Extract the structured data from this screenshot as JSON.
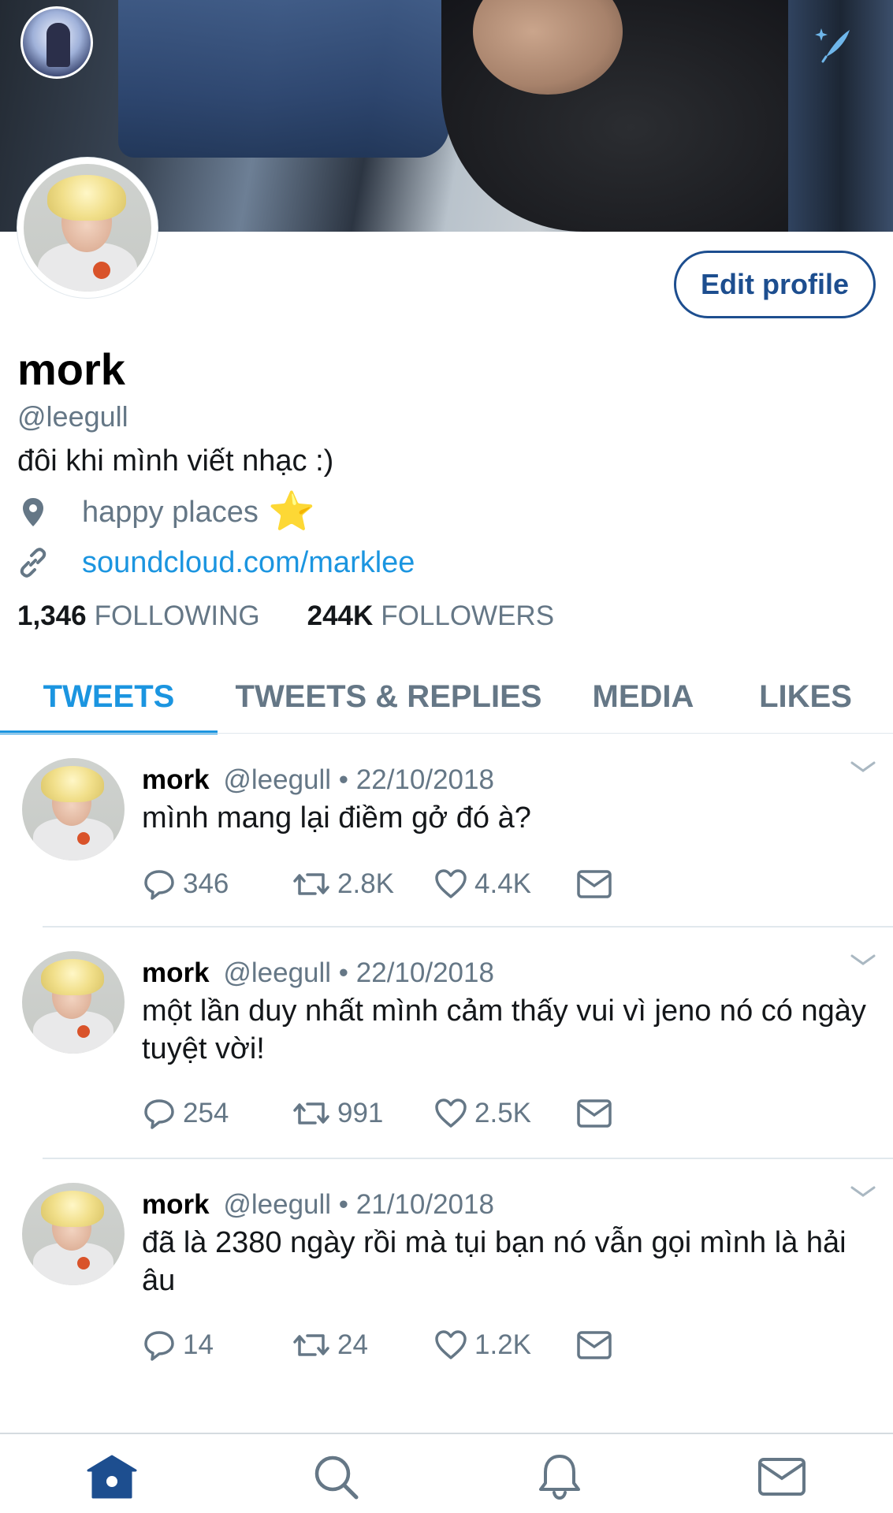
{
  "header": {
    "edit_profile_label": "Edit profile"
  },
  "profile": {
    "name": "mork",
    "handle": "@leegull",
    "bio": "đôi khi mình viết nhạc :)",
    "location": "happy places",
    "location_emoji": "⭐",
    "url": "soundcloud.com/marklee",
    "following_count": "1,346",
    "following_label": "FOLLOWING",
    "followers_count": "244K",
    "followers_label": "FOLLOWERS"
  },
  "tabs": [
    {
      "label": "TWEETS",
      "active": true
    },
    {
      "label": "TWEETS & REPLIES",
      "active": false
    },
    {
      "label": "MEDIA",
      "active": false
    },
    {
      "label": "LIKES",
      "active": false
    }
  ],
  "tweets": [
    {
      "name": "mork",
      "handle": "@leegull",
      "sep": "•",
      "date": "22/10/2018",
      "text": "mình mang lại điềm gở đó à?",
      "replies": "346",
      "retweets": "2.8K",
      "likes": "4.4K"
    },
    {
      "name": "mork",
      "handle": "@leegull",
      "sep": "•",
      "date": "22/10/2018",
      "text": "một lần duy nhất mình cảm thấy vui vì jeno nó có ngày tuyệt vời!",
      "replies": "254",
      "retweets": "991",
      "likes": "2.5K"
    },
    {
      "name": "mork",
      "handle": "@leegull",
      "sep": "•",
      "date": "21/10/2018",
      "text": "đã là 2380 ngày rồi mà tụi bạn nó vẫn gọi mình là hải âu",
      "replies": "14",
      "retweets": "24",
      "likes": "1.2K"
    }
  ],
  "icons": {
    "compose": "compose-sparkle-icon",
    "location": "location-pin-icon",
    "link": "link-icon",
    "reply": "reply-icon",
    "retweet": "retweet-icon",
    "like": "heart-icon",
    "dm": "envelope-icon",
    "nav_home": "home-icon",
    "nav_search": "search-icon",
    "nav_notifications": "bell-icon",
    "nav_messages": "envelope-icon"
  },
  "colors": {
    "accent": "#1b95e0",
    "edit_button": "#1d4e8f",
    "nav_active": "#1d4e8f",
    "muted": "#657786"
  }
}
